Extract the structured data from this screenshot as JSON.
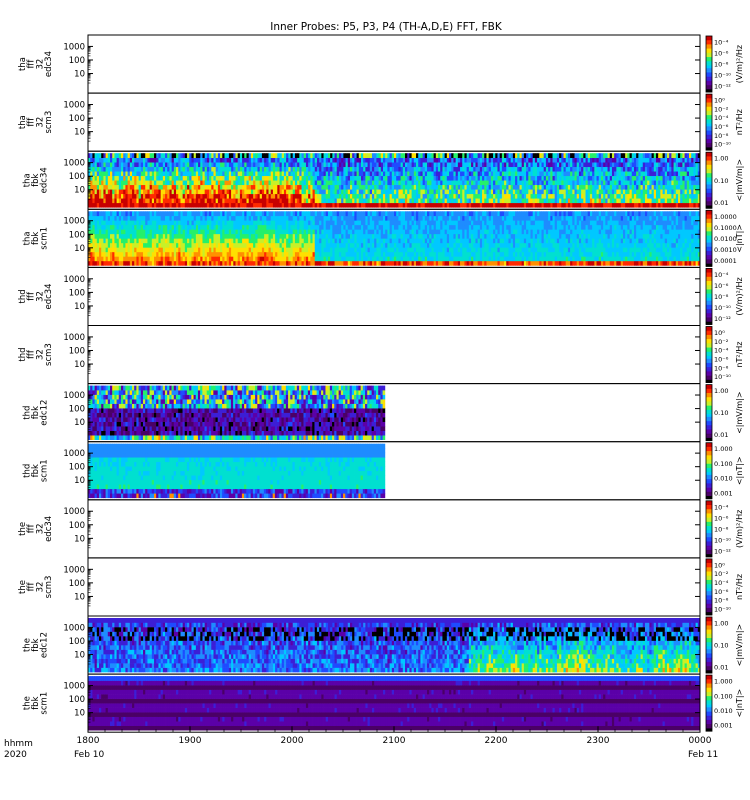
{
  "title": "Inner Probes: P5, P3, P4 (TH-A,D,E) FFT, FBK",
  "time_axis": {
    "ticks": [
      "1800",
      "1900",
      "2000",
      "2100",
      "2200",
      "2300",
      "0000"
    ],
    "start_date": "Feb 10",
    "end_date": "Feb 11",
    "label_line1": "hhmm",
    "label_line2": "2020"
  },
  "colors": {
    "background": "#ffffff",
    "frame": "#000000",
    "colormap": [
      "#000000",
      "#4a0066",
      "#5b00a8",
      "#3c1ed6",
      "#1f4bff",
      "#1e8cff",
      "#00c8ff",
      "#00e0d0",
      "#25f06a",
      "#c8f028",
      "#ffe000",
      "#ff9000",
      "#ff2a00",
      "#c80000"
    ]
  },
  "chart_data": [
    {
      "type": "heatmap",
      "probe": "tha",
      "ylabel": [
        "tha",
        "fff",
        "32",
        "edc34"
      ],
      "yticks": [
        "1000",
        "100",
        "10"
      ],
      "cbar_ticks": [
        "10⁻⁴",
        "10⁻⁶",
        "10⁻⁸",
        "10⁻¹⁰",
        "10⁻¹²"
      ],
      "cbar_label": "(V/m)²/Hz",
      "data_extent": [
        0,
        0
      ]
    },
    {
      "type": "heatmap",
      "probe": "tha",
      "ylabel": [
        "tha",
        "fff",
        "32",
        "scm3"
      ],
      "yticks": [
        "1000",
        "100",
        "10"
      ],
      "cbar_ticks": [
        "10⁰",
        "10⁻²",
        "10⁻⁴",
        "10⁻⁶",
        "10⁻⁸",
        "10⁻¹⁰"
      ],
      "cbar_label": "nT²/Hz",
      "data_extent": [
        0,
        0
      ]
    },
    {
      "type": "heatmap",
      "probe": "tha",
      "ylabel": [
        "tha",
        "fbk",
        "edc34"
      ],
      "yticks": [
        "1000",
        "100",
        "10"
      ],
      "cbar_ticks": [
        "1.00",
        "0.10",
        "0.01"
      ],
      "cbar_label": "<|mV/m|>",
      "data_extent": [
        0,
        1
      ],
      "style": "edc_active"
    },
    {
      "type": "heatmap",
      "probe": "tha",
      "ylabel": [
        "tha",
        "fbk",
        "scm1"
      ],
      "yticks": [
        "1000",
        "100",
        "10"
      ],
      "cbar_ticks": [
        "1.0000",
        "0.1000",
        "0.0100",
        "0.0010",
        "0.0001"
      ],
      "cbar_label": "<|nT|>",
      "data_extent": [
        0,
        1
      ],
      "style": "scm_active"
    },
    {
      "type": "heatmap",
      "probe": "thd",
      "ylabel": [
        "thd",
        "fff",
        "32",
        "edc34"
      ],
      "yticks": [
        "1000",
        "100",
        "10"
      ],
      "cbar_ticks": [
        "10⁻⁴",
        "10⁻⁶",
        "10⁻⁸",
        "10⁻¹⁰",
        "10⁻¹²"
      ],
      "cbar_label": "(V/m)²/Hz",
      "data_extent": [
        0,
        0
      ]
    },
    {
      "type": "heatmap",
      "probe": "thd",
      "ylabel": [
        "thd",
        "fff",
        "32",
        "scm3"
      ],
      "yticks": [
        "1000",
        "100",
        "10"
      ],
      "cbar_ticks": [
        "10⁰",
        "10⁻²",
        "10⁻⁴",
        "10⁻⁶",
        "10⁻⁸",
        "10⁻¹⁰"
      ],
      "cbar_label": "nT²/Hz",
      "data_extent": [
        0,
        0
      ]
    },
    {
      "type": "heatmap",
      "probe": "thd",
      "ylabel": [
        "thd",
        "fbk",
        "edc12"
      ],
      "yticks": [
        "1000",
        "100",
        "10"
      ],
      "cbar_ticks": [
        "1.00",
        "0.10",
        "0.01"
      ],
      "cbar_label": "<|mV/m|>",
      "data_extent": [
        0,
        0.485
      ],
      "style": "edc_dark"
    },
    {
      "type": "heatmap",
      "probe": "thd",
      "ylabel": [
        "thd",
        "fbk",
        "scm1"
      ],
      "yticks": [
        "1000",
        "100",
        "10"
      ],
      "cbar_ticks": [
        "1.000",
        "0.100",
        "0.010",
        "0.001"
      ],
      "cbar_label": "<|nT|>",
      "data_extent": [
        0,
        0.485
      ],
      "style": "scm_light"
    },
    {
      "type": "heatmap",
      "probe": "the",
      "ylabel": [
        "the",
        "fff",
        "32",
        "edc34"
      ],
      "yticks": [
        "1000",
        "100",
        "10"
      ],
      "cbar_ticks": [
        "10⁻⁴",
        "10⁻⁶",
        "10⁻⁸",
        "10⁻¹⁰",
        "10⁻¹²"
      ],
      "cbar_label": "(V/m)²/Hz",
      "data_extent": [
        0,
        0
      ]
    },
    {
      "type": "heatmap",
      "probe": "the",
      "ylabel": [
        "the",
        "fff",
        "32",
        "scm3"
      ],
      "yticks": [
        "1000",
        "100",
        "10"
      ],
      "cbar_ticks": [
        "10⁰",
        "10⁻²",
        "10⁻⁴",
        "10⁻⁶",
        "10⁻⁸",
        "10⁻¹⁰"
      ],
      "cbar_label": "nT²/Hz",
      "data_extent": [
        0,
        0
      ]
    },
    {
      "type": "heatmap",
      "probe": "the",
      "ylabel": [
        "the",
        "fbk",
        "edc12"
      ],
      "yticks": [
        "1000",
        "100",
        "10"
      ],
      "cbar_ticks": [
        "1.00",
        "0.10",
        "0.01"
      ],
      "cbar_label": "<|mV/m|>",
      "data_extent": [
        0,
        1
      ],
      "style": "edc_blue"
    },
    {
      "type": "heatmap",
      "probe": "the",
      "ylabel": [
        "the",
        "fbk",
        "scm1"
      ],
      "yticks": [
        "1000",
        "100",
        "10"
      ],
      "cbar_ticks": [
        "1.000",
        "0.100",
        "0.010",
        "0.001"
      ],
      "cbar_label": "<|nT|>",
      "data_extent": [
        0,
        1
      ],
      "style": "scm_purple"
    }
  ]
}
